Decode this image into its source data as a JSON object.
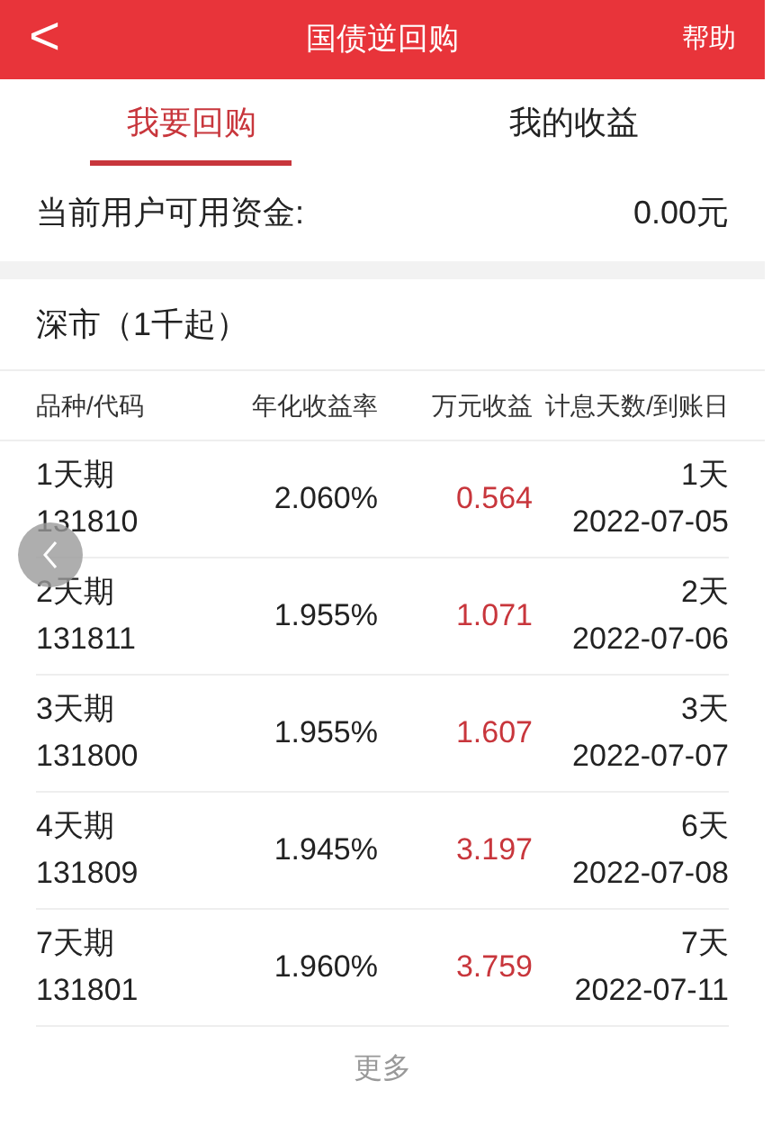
{
  "header": {
    "back": "<",
    "title": "国债逆回购",
    "help": "帮助"
  },
  "tabs": [
    {
      "label": "我要回购",
      "selected": true
    },
    {
      "label": "我的收益",
      "selected": false
    }
  ],
  "funds": {
    "label": "当前用户可用资金:",
    "value": "0.00元"
  },
  "section_title": "深市（1千起）",
  "table": {
    "columns": [
      "品种/代码",
      "年化收益率",
      "万元收益",
      "计息天数/到账日"
    ],
    "rows": [
      {
        "term": "1天期",
        "code": "131810",
        "rate": "2.060%",
        "income": "0.564",
        "days": "1天",
        "date": "2022-07-05"
      },
      {
        "term": "2天期",
        "code": "131811",
        "rate": "1.955%",
        "income": "1.071",
        "days": "2天",
        "date": "2022-07-06"
      },
      {
        "term": "3天期",
        "code": "131800",
        "rate": "1.955%",
        "income": "1.607",
        "days": "3天",
        "date": "2022-07-07"
      },
      {
        "term": "4天期",
        "code": "131809",
        "rate": "1.945%",
        "income": "3.197",
        "days": "6天",
        "date": "2022-07-08"
      },
      {
        "term": "7天期",
        "code": "131801",
        "rate": "1.960%",
        "income": "3.759",
        "days": "7天",
        "date": "2022-07-11"
      }
    ]
  },
  "more": "更多"
}
